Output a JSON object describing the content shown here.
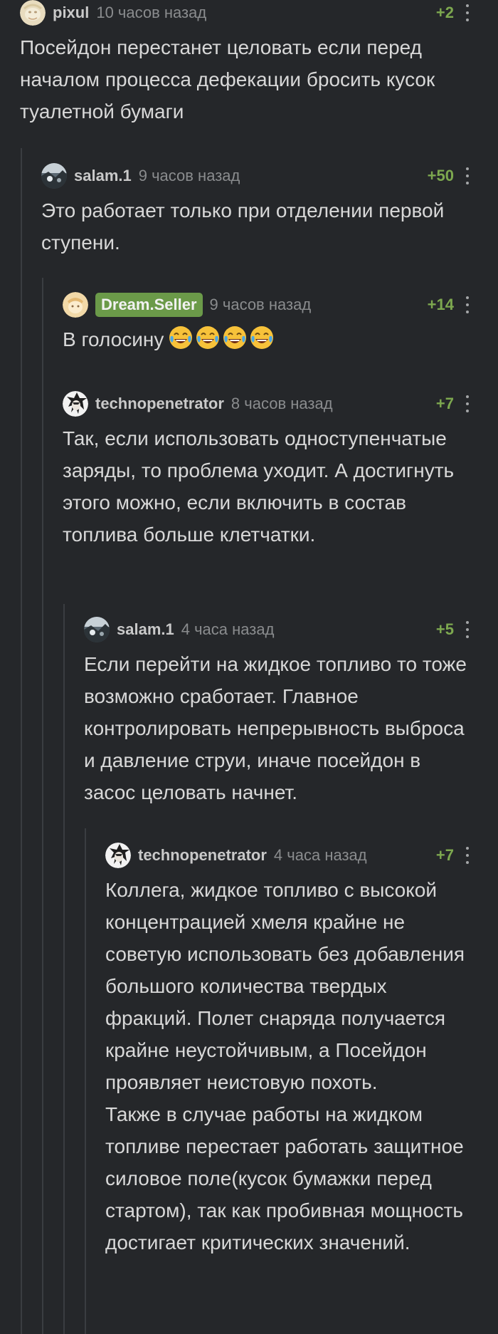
{
  "comments": [
    {
      "username": "pixul",
      "time": "10 часов назад",
      "rating": "+2",
      "text": "Посейдон перестанет целовать если перед началом процесса дефекации бросить кусок туалетной бумаги",
      "avatar": "pixul-avatar"
    },
    {
      "username": "salam.1",
      "time": "9 часов назад",
      "rating": "+50",
      "text": "Это работает только при отделении первой ступени.",
      "avatar": "salam-avatar"
    },
    {
      "username": "Dream.Seller",
      "time": "9 часов назад",
      "rating": "+14",
      "text": "В голосину",
      "emoji": "😂😂😂😂",
      "avatar": "dream-seller-avatar"
    },
    {
      "username": "technopenetrator",
      "time": "8 часов назад",
      "rating": "+7",
      "text": "Так, если использовать одноступенчатые заряды, то проблема уходит. А достигнуть этого можно, если включить в состав топлива больше клетчатки.",
      "avatar": "technopenetrator-avatar"
    },
    {
      "username": "salam.1",
      "time": "4 часа назад",
      "rating": "+5",
      "text": "Если перейти на жидкое топливо то тоже возможно сработает. Главное контролировать непрерывность выброса и давление струи, иначе посейдон в засос целовать начнет.",
      "avatar": "salam-avatar"
    },
    {
      "username": "technopenetrator",
      "time": "4 часа назад",
      "rating": "+7",
      "text": "Коллега, жидкое топливо с высокой концентрацией хмеля крайне не советую использовать без добавления большого количества твердых фракций. Полет снаряда получается крайне неустойчивым, а Посейдон проявляет неистовую похоть.\nТакже в случае работы на жидком топливе перестает работать защитное силовое поле(кусок бумажки перед стартом), так как пробивная мощность достигает критических значений.",
      "avatar": "technopenetrator-avatar"
    }
  ],
  "colors": {
    "background": "#25272a",
    "rating": "#7da84f",
    "badge": "#6b9a49",
    "thread_line": "#3a3d41"
  }
}
